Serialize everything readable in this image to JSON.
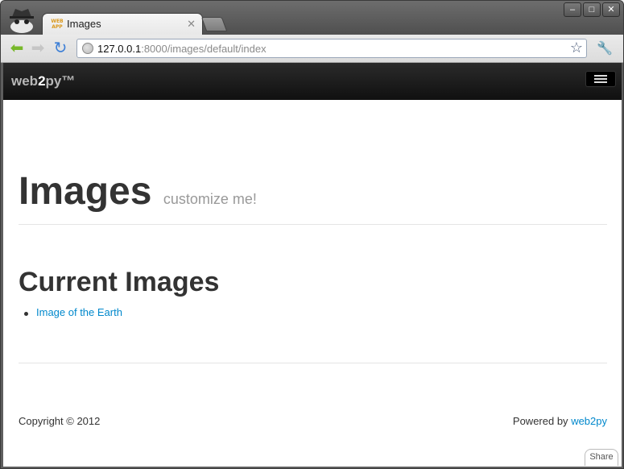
{
  "browser": {
    "tab_title": "Images",
    "tab_favicon": "WEB APP",
    "url_host": "127.0.0.1",
    "url_rest": ":8000/images/default/index",
    "window_controls": [
      "minimize",
      "maximize",
      "close"
    ]
  },
  "navbar": {
    "brand_prefix": "web",
    "brand_two": "2",
    "brand_suffix": "py™"
  },
  "page": {
    "title": "Images",
    "subtitle": "customize me!",
    "section_title": "Current Images",
    "images": [
      {
        "label": "Image of the Earth"
      }
    ]
  },
  "footer": {
    "copyright": "Copyright © 2012",
    "powered_by": "Powered by",
    "powered_link": "web2py"
  },
  "share_label": "Share",
  "colors": {
    "link": "#0088cc",
    "navbar": "#1b1b1b"
  }
}
